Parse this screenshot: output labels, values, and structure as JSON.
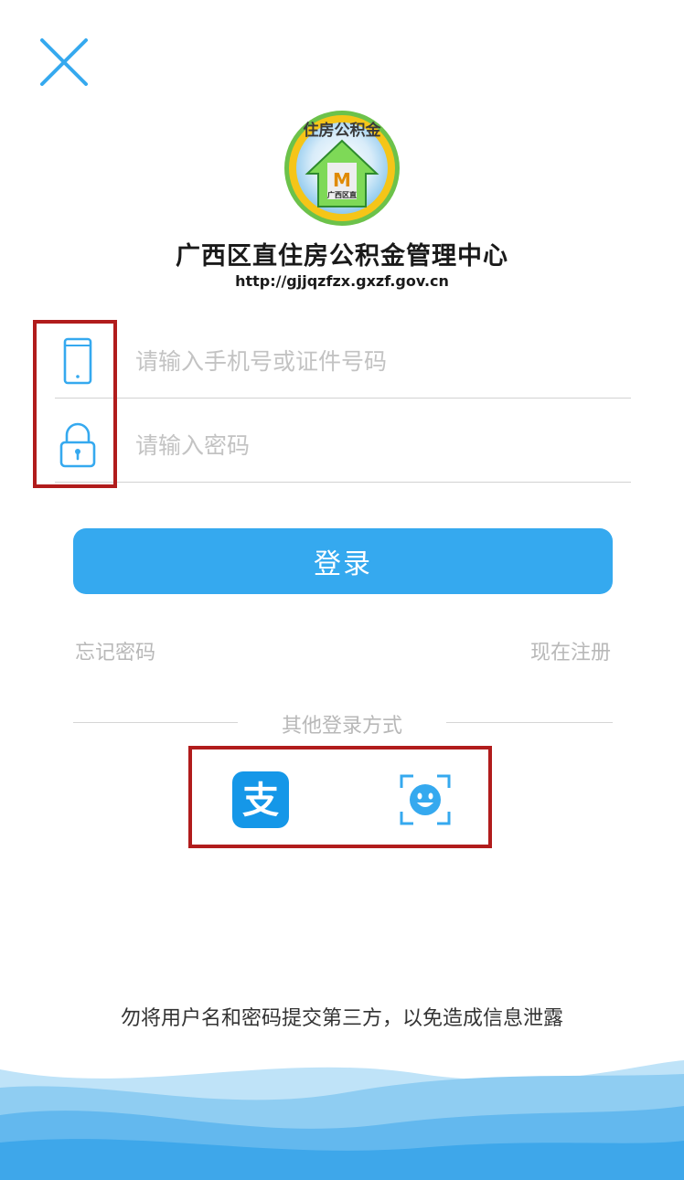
{
  "header": {
    "close_icon": "close-icon"
  },
  "brand": {
    "logo_icon": "housing-fund-logo",
    "logo_text": "住房公积金",
    "logo_mark": "M",
    "logo_region": "广西区直",
    "org_name": "广西区直住房公积金管理中心",
    "url": "http://gjjqzfzx.gxzf.gov.cn"
  },
  "form": {
    "account": {
      "icon": "phone-icon",
      "placeholder": "请输入手机号或证件号码",
      "value": ""
    },
    "password": {
      "icon": "lock-icon",
      "placeholder": "请输入密码",
      "value": ""
    },
    "login_label": "登录",
    "forgot_label": "忘记密码",
    "register_label": "现在注册"
  },
  "alt_login": {
    "title": "其他登录方式",
    "alipay_icon": "alipay-icon",
    "alipay_glyph": "支",
    "face_icon": "face-recognition-icon"
  },
  "footer": {
    "warning": "勿将用户名和密码提交第三方，以免造成信息泄露"
  },
  "colors": {
    "accent": "#35a9ef",
    "annotation": "#b11c1c",
    "placeholder": "#c3c3c3",
    "link": "#b8b8b8",
    "wave_dark": "#3ea7ea",
    "wave_light": "#bfe3f8"
  }
}
